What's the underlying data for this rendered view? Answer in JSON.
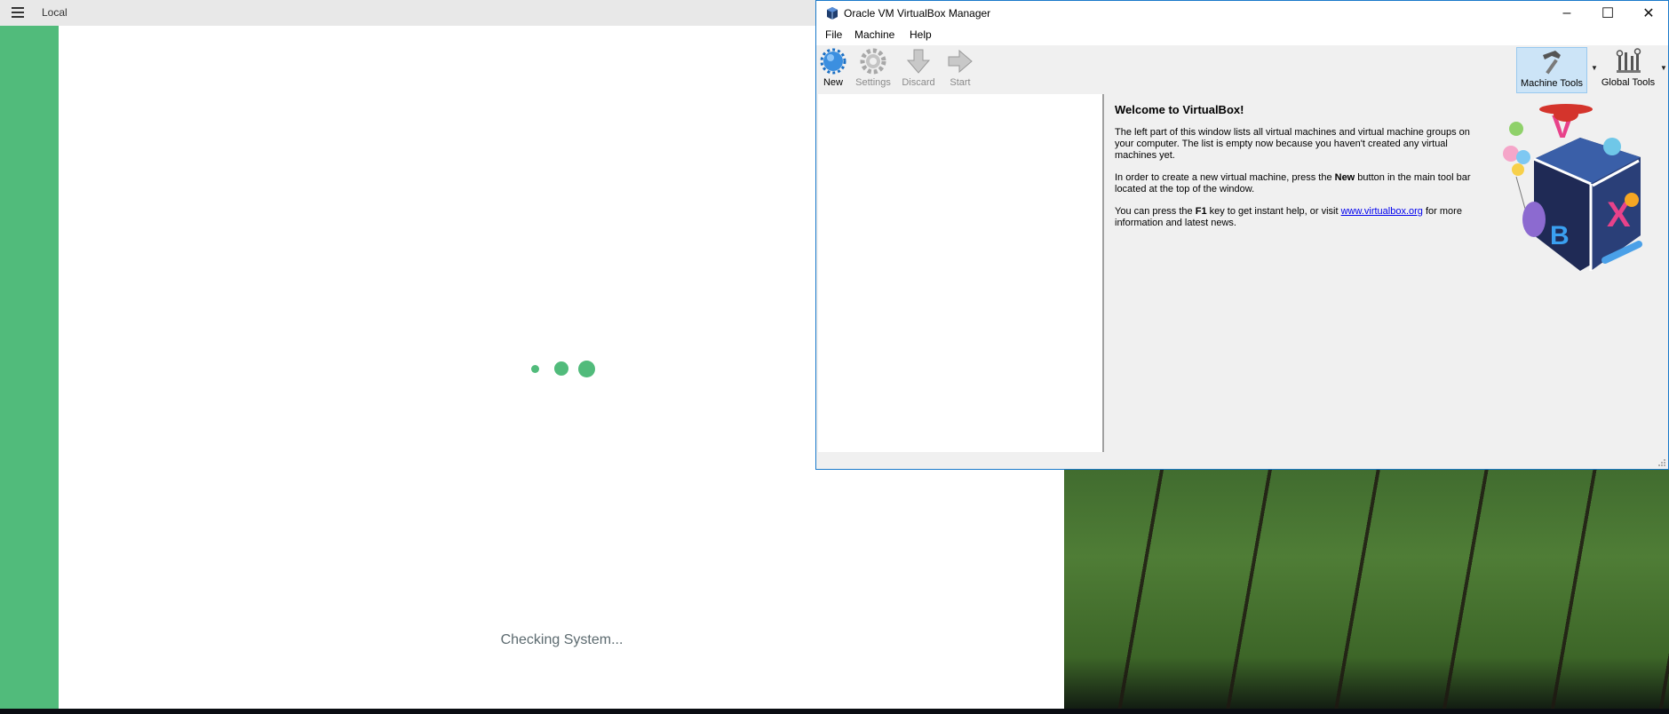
{
  "local_app": {
    "title": "Local",
    "status": "Checking System...",
    "accent_color": "#51bb7b"
  },
  "vbox": {
    "title": "Oracle VM VirtualBox Manager",
    "menu": [
      "File",
      "Machine",
      "Help"
    ],
    "toolbar": {
      "new": "New",
      "settings": "Settings",
      "discard": "Discard",
      "start": "Start",
      "machine_tools": "Machine Tools",
      "global_tools": "Global Tools"
    },
    "welcome": {
      "title": "Welcome to VirtualBox!",
      "p1": "The left part of this window lists all virtual machines and virtual machine groups on your computer. The list is empty now because you haven't created any virtual machines yet.",
      "p2_a": "In order to create a new virtual machine, press the ",
      "p2_b": "New",
      "p2_c": " button in the main tool bar located at the top of the window.",
      "p3_a": "You can press the ",
      "p3_b": "F1",
      "p3_c": " key to get instant help, or visit ",
      "p3_link": "www.virtualbox.org",
      "p3_d": " for more information and latest news."
    }
  }
}
